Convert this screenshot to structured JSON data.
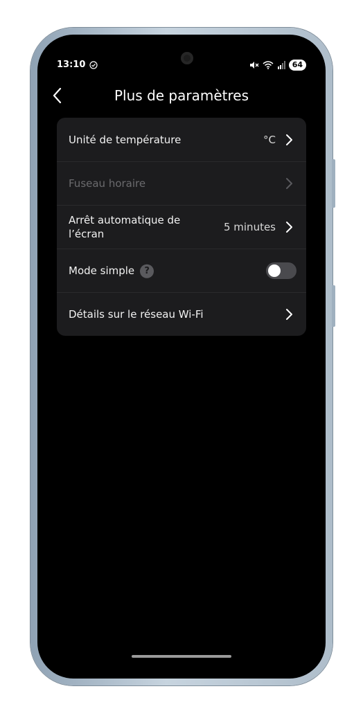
{
  "status_bar": {
    "time": "13:10",
    "battery": "64",
    "sync_icon": "check-circle-icon",
    "mute_icon": "mute-icon",
    "wifi_icon": "wifi-icon",
    "signal_icon": "signal-icon"
  },
  "header": {
    "title": "Plus de paramètres",
    "back_icon": "chevron-left-icon"
  },
  "settings": [
    {
      "label": "Unité de température",
      "value": "°C",
      "enabled": true
    },
    {
      "label": "Fuseau horaire",
      "value": "",
      "enabled": false
    },
    {
      "label": "Arrêt automatique de l’écran",
      "value": "5 minutes",
      "enabled": true
    },
    {
      "label": "Mode simple",
      "help": "?",
      "toggle": false,
      "enabled": true
    },
    {
      "label": "Détails sur le réseau Wi-Fi",
      "value": "",
      "enabled": true
    }
  ],
  "colors": {
    "background": "#000000",
    "card": "#1c1c1e",
    "text": "#f2f2f2",
    "disabled_text": "#6b6b6e",
    "toggle_off": "#4a4a4e"
  }
}
